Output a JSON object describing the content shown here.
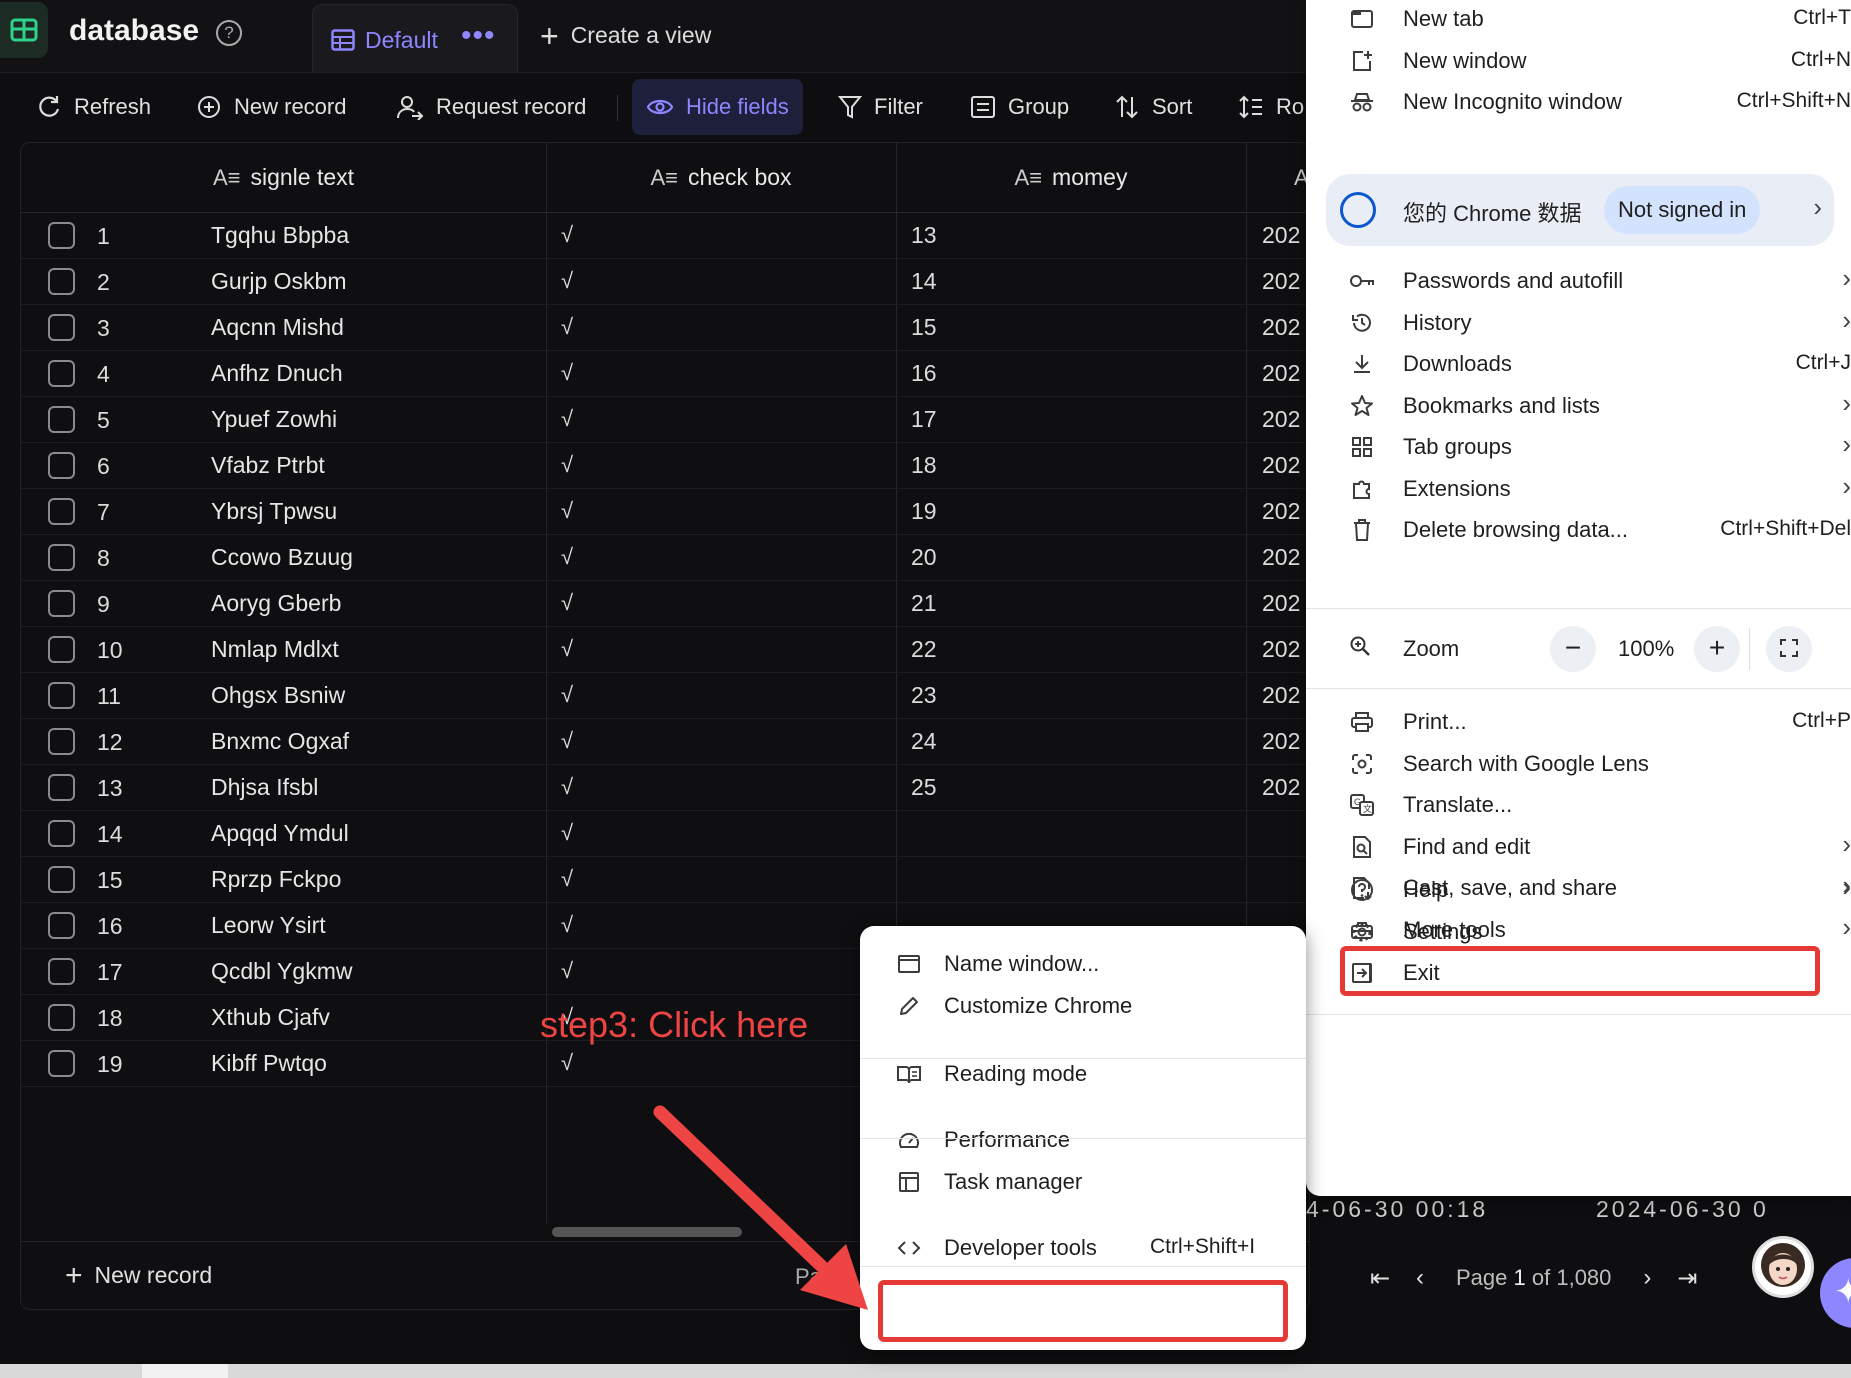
{
  "app": {
    "title": "database",
    "view_tab": "Default",
    "view_more": "•••",
    "create_view": "Create a view"
  },
  "toolbar": {
    "refresh": "Refresh",
    "new_record": "New record",
    "request_record": "Request record",
    "hide_fields": "Hide fields",
    "filter": "Filter",
    "group": "Group",
    "sort": "Sort",
    "row_partial": "Ro"
  },
  "table": {
    "columns": [
      "signle text",
      "check box",
      "momey",
      ""
    ],
    "rows": [
      {
        "n": "1",
        "text": "Tgqhu Bbpba",
        "check": "√",
        "money": "13",
        "date": "202"
      },
      {
        "n": "2",
        "text": "Gurjp Oskbm",
        "check": "√",
        "money": "14",
        "date": "202"
      },
      {
        "n": "3",
        "text": "Aqcnn Mishd",
        "check": "√",
        "money": "15",
        "date": "202"
      },
      {
        "n": "4",
        "text": "Anfhz Dnuch",
        "check": "√",
        "money": "16",
        "date": "202"
      },
      {
        "n": "5",
        "text": "Ypuef Zowhi",
        "check": "√",
        "money": "17",
        "date": "202"
      },
      {
        "n": "6",
        "text": "Vfabz Ptrbt",
        "check": "√",
        "money": "18",
        "date": "202"
      },
      {
        "n": "7",
        "text": "Ybrsj Tpwsu",
        "check": "√",
        "money": "19",
        "date": "202"
      },
      {
        "n": "8",
        "text": "Ccowo Bzuug",
        "check": "√",
        "money": "20",
        "date": "202"
      },
      {
        "n": "9",
        "text": "Aoryg Gberb",
        "check": "√",
        "money": "21",
        "date": "202"
      },
      {
        "n": "10",
        "text": "Nmlap Mdlxt",
        "check": "√",
        "money": "22",
        "date": "202"
      },
      {
        "n": "11",
        "text": "Ohgsx Bsniw",
        "check": "√",
        "money": "23",
        "date": "202"
      },
      {
        "n": "12",
        "text": "Bnxmc Ogxaf",
        "check": "√",
        "money": "24",
        "date": "202"
      },
      {
        "n": "13",
        "text": "Dhjsa Ifsbl",
        "check": "√",
        "money": "25",
        "date": "202"
      },
      {
        "n": "14",
        "text": "Apqqd Ymdul",
        "check": "√",
        "money": "",
        "date": ""
      },
      {
        "n": "15",
        "text": "Rprzp Fckpo",
        "check": "√",
        "money": "",
        "date": ""
      },
      {
        "n": "16",
        "text": "Leorw Ysirt",
        "check": "√",
        "money": "",
        "date": ""
      },
      {
        "n": "17",
        "text": "Qcdbl Ygkmw",
        "check": "√",
        "money": "",
        "date": ""
      },
      {
        "n": "18",
        "text": "Xthub Cjafv",
        "check": "√",
        "money": "",
        "date": ""
      },
      {
        "n": "19",
        "text": "Kibff Pwtqo",
        "check": "√",
        "money": "",
        "date": ""
      }
    ],
    "underlay_dates": [
      "4-06-30 00:18",
      "2024-06-30 0"
    ]
  },
  "footer": {
    "new_record": "New record",
    "page_prefix_partial": "Pa",
    "page_word": "Page",
    "page_current": "1",
    "page_of": "of 1,080"
  },
  "chrome_menu": {
    "items_top": [
      {
        "label": "New tab",
        "shortcut": "Ctrl+T",
        "icon": "new-tab-icon"
      },
      {
        "label": "New window",
        "shortcut": "Ctrl+N",
        "icon": "new-window-icon"
      },
      {
        "label": "New Incognito window",
        "shortcut": "Ctrl+Shift+N",
        "icon": "incognito-icon"
      }
    ],
    "profile": {
      "label": "您的 Chrome 数据",
      "badge": "Not signed in"
    },
    "items_mid": [
      {
        "label": "Passwords and autofill",
        "shortcut": "",
        "icon": "key-icon",
        "sub": true
      },
      {
        "label": "History",
        "shortcut": "",
        "icon": "history-icon",
        "sub": true
      },
      {
        "label": "Downloads",
        "shortcut": "Ctrl+J",
        "icon": "download-icon",
        "sub": false
      },
      {
        "label": "Bookmarks and lists",
        "shortcut": "",
        "icon": "star-icon",
        "sub": true
      },
      {
        "label": "Tab groups",
        "shortcut": "",
        "icon": "tab-groups-icon",
        "sub": true
      },
      {
        "label": "Extensions",
        "shortcut": "",
        "icon": "puzzle-icon",
        "sub": true
      },
      {
        "label": "Delete browsing data...",
        "shortcut": "Ctrl+Shift+Del",
        "icon": "trash-icon",
        "sub": false
      }
    ],
    "zoom": {
      "label": "Zoom",
      "minus": "−",
      "value": "100%",
      "plus": "+"
    },
    "items_tools": [
      {
        "label": "Print...",
        "shortcut": "Ctrl+P",
        "icon": "print-icon",
        "sub": false
      },
      {
        "label": "Search with Google Lens",
        "shortcut": "",
        "icon": "lens-icon",
        "sub": false
      },
      {
        "label": "Translate...",
        "shortcut": "",
        "icon": "translate-icon",
        "sub": false
      },
      {
        "label": "Find and edit",
        "shortcut": "",
        "icon": "find-icon",
        "sub": true
      },
      {
        "label": "Cast, save, and share",
        "shortcut": "",
        "icon": "cast-icon",
        "sub": true
      },
      {
        "label": "More tools",
        "shortcut": "",
        "icon": "toolbox-icon",
        "sub": true
      }
    ],
    "items_bottom": [
      {
        "label": "Help",
        "shortcut": "",
        "icon": "help-icon",
        "sub": true
      },
      {
        "label": "Settings",
        "shortcut": "",
        "icon": "settings-icon",
        "sub": false
      },
      {
        "label": "Exit",
        "shortcut": "",
        "icon": "exit-icon",
        "sub": false
      }
    ]
  },
  "more_tools_submenu": {
    "items": [
      {
        "label": "Name window...",
        "shortcut": "",
        "icon": "window-icon"
      },
      {
        "label": "Customize Chrome",
        "shortcut": "",
        "icon": "pencil-icon"
      },
      {
        "label": "Reading mode",
        "shortcut": "",
        "icon": "book-icon"
      },
      {
        "label": "Performance",
        "shortcut": "",
        "icon": "gauge-icon"
      },
      {
        "label": "Task manager",
        "shortcut": "",
        "icon": "task-manager-icon"
      },
      {
        "label": "Developer tools",
        "shortcut": "Ctrl+Shift+I",
        "icon": "code-icon"
      }
    ]
  },
  "annotation": {
    "step_text": "step3: Click here",
    "color": "#ef4444"
  },
  "colors": {
    "accent": "#8d86ff",
    "background": "#0e0e10",
    "menu_bg": "#ffffff",
    "highlight": "#e53935"
  }
}
